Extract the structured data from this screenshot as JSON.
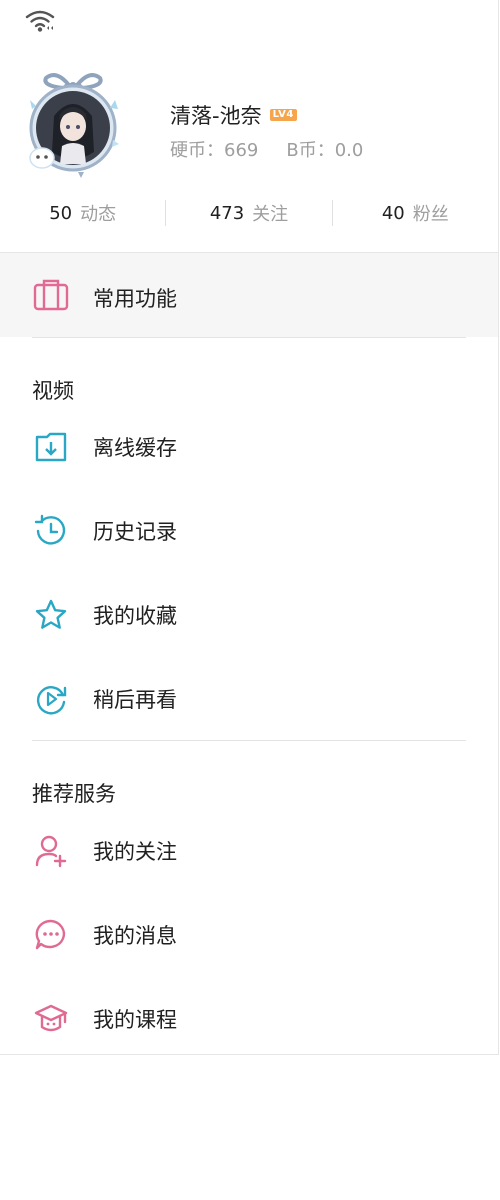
{
  "profile": {
    "username": "清落-池奈",
    "level": "LV4",
    "coins_label": "硬币：669",
    "bcoins_label": "B币：0.0"
  },
  "stats": [
    {
      "value": "50",
      "label": "动态"
    },
    {
      "value": "473",
      "label": "关注"
    },
    {
      "value": "40",
      "label": "粉丝"
    }
  ],
  "common": {
    "label": "常用功能"
  },
  "video_section": {
    "title": "视频",
    "items": [
      {
        "label": "离线缓存",
        "icon": "download-folder-icon"
      },
      {
        "label": "历史记录",
        "icon": "history-clock-icon"
      },
      {
        "label": "我的收藏",
        "icon": "star-icon"
      },
      {
        "label": "稍后再看",
        "icon": "watch-later-icon"
      }
    ]
  },
  "recommend_section": {
    "title": "推荐服务",
    "items": [
      {
        "label": "我的关注",
        "icon": "add-user-icon"
      },
      {
        "label": "我的消息",
        "icon": "message-bubble-icon"
      },
      {
        "label": "我的课程",
        "icon": "graduation-cap-icon"
      }
    ]
  },
  "colors": {
    "teal_icon": "#2aa7c4",
    "pink_icon": "#e06a93",
    "gray_text": "#9e9e9e",
    "level_badge": "#f7a54a"
  }
}
